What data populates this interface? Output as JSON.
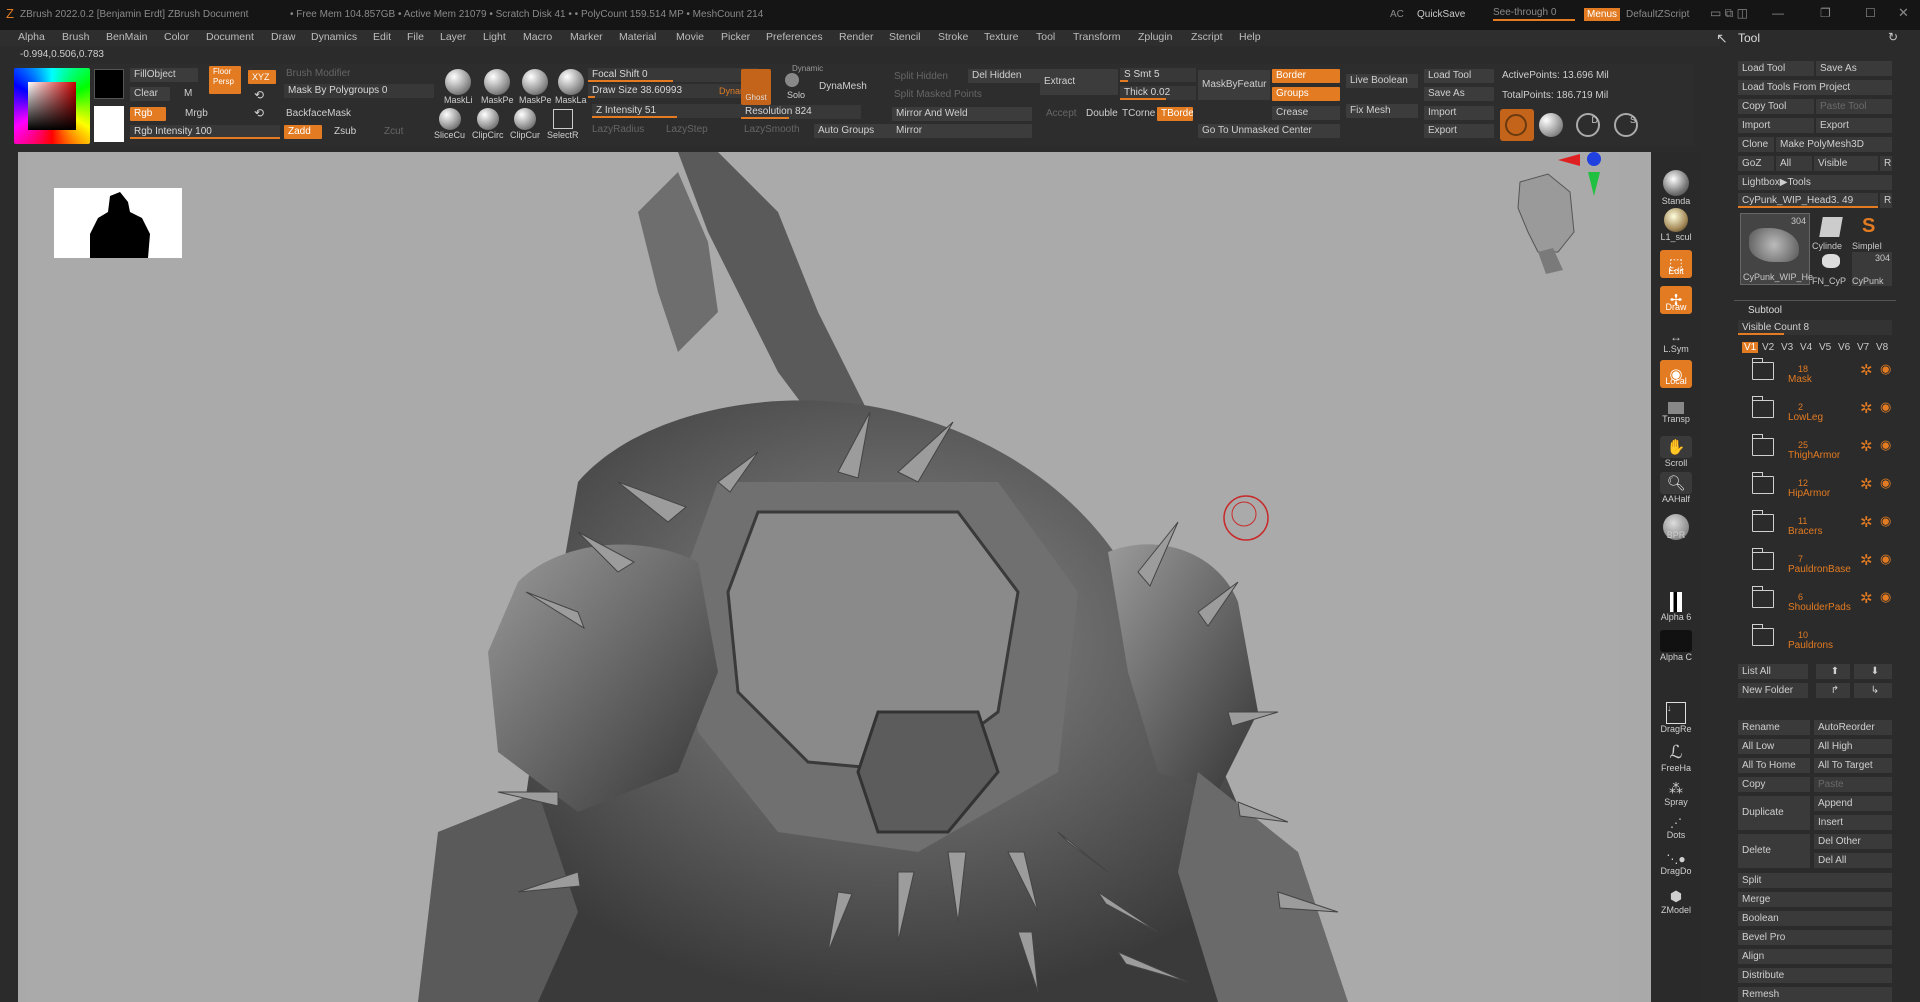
{
  "titlebar": {
    "app": "ZBrush 2022.0.2 [Benjamin Erdt]   ZBrush Document",
    "stats": "• Free Mem 104.857GB • Active Mem 21079 • Scratch Disk 41 •  • PolyCount 159.514 MP   • MeshCount 214",
    "ac": "AC",
    "quicksave": "QuickSave",
    "seethrough": "See-through  0",
    "menus": "Menus",
    "script": "DefaultZScript"
  },
  "menu": [
    "Alpha",
    "Brush",
    "BenMain",
    "Color",
    "Document",
    "Draw",
    "Dynamics",
    "Edit",
    "File",
    "Layer",
    "Light",
    "Macro",
    "Marker",
    "Material",
    "Movie",
    "Picker",
    "Preferences",
    "Render",
    "Stencil",
    "Stroke",
    "Texture",
    "Tool",
    "Transform",
    "Zplugin",
    "Zscript",
    "Help"
  ],
  "coords": "-0.994,0.506,0.783",
  "colors": {
    "accent": "#e27b22",
    "viewport": "#a9a9a9"
  },
  "shelf": {
    "fillobject": "FillObject",
    "clear": "Clear",
    "m": "M",
    "rgb": "Rgb",
    "mrgb": "Mrgb",
    "rgb_intensity": "Rgb Intensity 100",
    "zadd": "Zadd",
    "zsub": "Zsub",
    "zcut": "Zcut",
    "persp": "Persp",
    "floor": "Floor",
    "xyz": "XYZ",
    "brush_modifier": "Brush Modifier",
    "mask_by_polygroups": "Mask By Polygroups 0",
    "backfacemask": "BackfaceMask",
    "icons1": [
      "MaskLi",
      "MaskPe",
      "MaskPe",
      "MaskLa"
    ],
    "icons2": [
      "SliceCu",
      "ClipCirc",
      "ClipCur",
      "SelectR"
    ],
    "focal_shift": "Focal Shift 0",
    "draw_size": "Draw Size 38.60993",
    "dynamic": "Dynamic",
    "z_intensity": "Z Intensity 51",
    "lazyradius": "LazyRadius",
    "lazystep": "LazyStep",
    "ghost": "Ghost",
    "solo": "Solo",
    "dynamic2": "Dynamic",
    "dynamesh": "DynaMesh",
    "resolution": "Resolution 824",
    "lazysmooth": "LazySmooth",
    "auto_groups": "Auto Groups",
    "split_hidden": "Split Hidden",
    "del_hidden": "Del Hidden",
    "split_masked": "Split Masked Points",
    "mirror_weld": "Mirror And Weld",
    "mirror": "Mirror",
    "extract": "Extract",
    "accept": "Accept",
    "double": "Double",
    "tcorner": "TCorne",
    "tborder": "TBorde",
    "ssmt": "S Smt 5",
    "thick": "Thick 0.02",
    "maskbyfeature": "MaskByFeatur",
    "goto_unmasked": "Go To Unmasked Center",
    "border": "Border",
    "groups": "Groups",
    "crease": "Crease",
    "live_boolean": "Live Boolean",
    "fix_mesh": "Fix Mesh",
    "load_tool": "Load Tool",
    "save_as": "Save As",
    "import": "Import",
    "export": "Export",
    "active_points": "ActivePoints: 13.696 Mil",
    "total_points": "TotalPoints: 186.719 Mil"
  },
  "right_strip": [
    "Standa",
    "L1_scul",
    "Edit",
    "Draw",
    "L.Sym",
    "Local",
    "Transp",
    "Scroll",
    "AAHalf",
    "BPR",
    "Alpha 6",
    "Alpha C",
    "DragRe",
    "FreeHa",
    "Spray",
    "Dots",
    "DragDo",
    "ZModel"
  ],
  "tool_panel": {
    "title": "Tool",
    "load_tool": "Load Tool",
    "save_as": "Save As",
    "load_from_project": "Load Tools From Project",
    "copy_tool": "Copy Tool",
    "paste_tool": "Paste Tool",
    "import": "Import",
    "export": "Export",
    "clone": "Clone",
    "make_polymesh": "Make PolyMesh3D",
    "goz": "GoZ",
    "all": "All",
    "visible": "Visible",
    "r": "R",
    "lightbox": "Lightbox▶Tools",
    "current_tool": "CyPunk_WIP_Head3. 49",
    "r2": "R",
    "thumbs": [
      {
        "label": "CyPunk_WIP_He",
        "count": "304"
      },
      {
        "label": "Cylinde",
        "count": ""
      },
      {
        "label": "SimpleI",
        "count": ""
      },
      {
        "label": "FN_CyP",
        "count": ""
      },
      {
        "label": "CyPunk",
        "count": "304"
      }
    ],
    "subtool": "Subtool",
    "visible_count": "Visible Count 8",
    "versions": [
      "V1",
      "V2",
      "V3",
      "V4",
      "V5",
      "V6",
      "V7",
      "V8"
    ],
    "subtools": [
      {
        "count": "18",
        "name": "Mask"
      },
      {
        "count": "2",
        "name": "LowLeg"
      },
      {
        "count": "25",
        "name": "ThighArmor"
      },
      {
        "count": "12",
        "name": "HipArmor"
      },
      {
        "count": "11",
        "name": "Bracers"
      },
      {
        "count": "7",
        "name": "PauldronBase"
      },
      {
        "count": "6",
        "name": "ShoulderPads"
      },
      {
        "count": "10",
        "name": "Pauldrons"
      }
    ],
    "list_all": "List All",
    "new_folder": "New Folder",
    "rename": "Rename",
    "autoreorder": "AutoReorder",
    "all_low": "All Low",
    "all_high": "All High",
    "all_to_home": "All To Home",
    "all_to_target": "All To Target",
    "copy": "Copy",
    "paste": "Paste",
    "duplicate": "Duplicate",
    "append": "Append",
    "insert": "Insert",
    "delete": "Delete",
    "del_other": "Del Other",
    "del_all": "Del All",
    "split": "Split",
    "merge": "Merge",
    "boolean": "Boolean",
    "bevel_pro": "Bevel Pro",
    "align": "Align",
    "distribute": "Distribute",
    "remesh": "Remesh"
  }
}
